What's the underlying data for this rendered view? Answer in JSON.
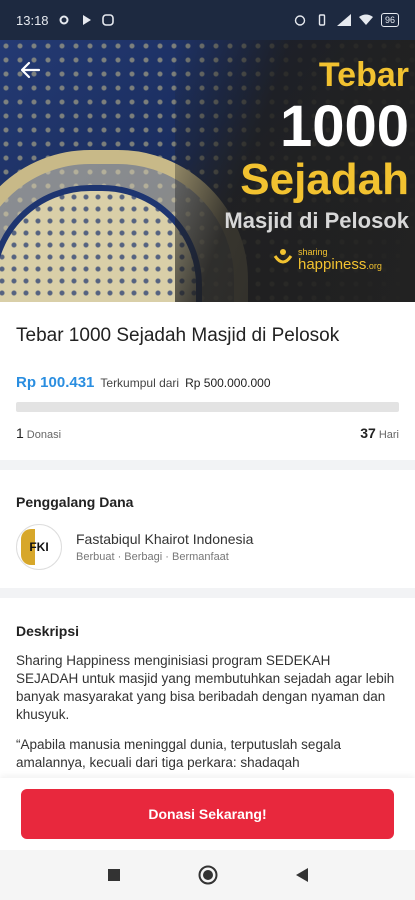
{
  "status_bar": {
    "time": "13:18",
    "battery": "96"
  },
  "hero": {
    "line1": "Tebar",
    "line2": "1000",
    "line3": "Sejadah",
    "line4": "Masjid di Pelosok",
    "logo_small": "sharing",
    "logo_big": "happiness",
    "logo_suffix": ".org"
  },
  "campaign": {
    "title": "Tebar 1000 Sejadah Masjid di Pelosok",
    "collected": "Rp 100.431",
    "collected_label": "Terkumpul dari",
    "target": "Rp 500.000.000",
    "progress": 0.0002,
    "donations_count": "1",
    "donations_label": "Donasi",
    "days_left": "37",
    "days_label": "Hari"
  },
  "fundraiser": {
    "section_title": "Penggalang Dana",
    "logo_text": "FKI",
    "name": "Fastabiqul Khairot Indonesia",
    "tagline": "Berbuat · Berbagi · Bermanfaat"
  },
  "description": {
    "section_title": "Deskripsi",
    "paragraph1": "Sharing Happiness menginisiasi program SEDEKAH SEJADAH untuk masjid yang membutuhkan sejadah agar lebih banyak masyarakat yang bisa beribadah dengan nyaman dan khusyuk.",
    "paragraph2": "“Apabila manusia meninggal dunia, terputuslah segala amalannya, kecuali dari tiga perkara: shadaqah"
  },
  "cta": {
    "label": "Donasi Sekarang!"
  },
  "colors": {
    "accent_blue": "#2a8ee0",
    "cta_red": "#e8283d",
    "gold": "#f2c230"
  }
}
